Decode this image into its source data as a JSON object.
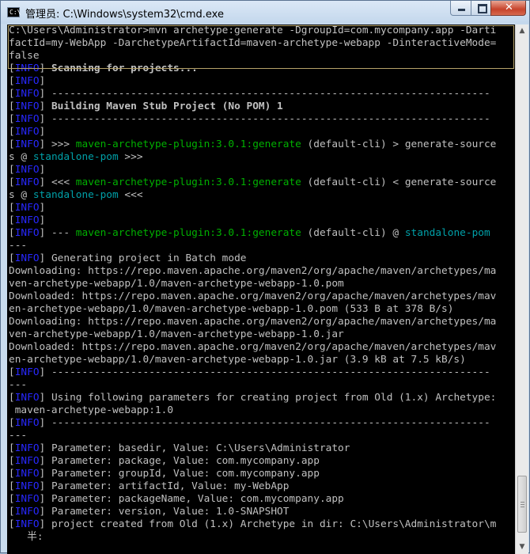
{
  "window": {
    "title": "管理员: C:\\Windows\\system32\\cmd.exe",
    "icon_text": "C:\\",
    "controls": {
      "minimize": "minimize-icon",
      "maximize": "maximize-icon",
      "close": "✕"
    }
  },
  "console": {
    "lines": [
      "C:\\Users\\Administrator>mvn archetype:generate -DgroupId=com.mycompany.app -Darti",
      "factId=my-WebApp -DarchetypeArtifactId=maven-archetype-webapp -DinteractiveMode=",
      "false",
      "[INFO] Scanning for projects...",
      "[INFO]",
      "[INFO] ------------------------------------------------------------------------",
      "[INFO] Building Maven Stub Project (No POM) 1",
      "[INFO] ------------------------------------------------------------------------",
      "[INFO]",
      "[INFO] >>> maven-archetype-plugin:3.0.1:generate (default-cli) > generate-source",
      "s @ standalone-pom >>>",
      "[INFO]",
      "[INFO] <<< maven-archetype-plugin:3.0.1:generate (default-cli) < generate-source",
      "s @ standalone-pom <<<",
      "[INFO]",
      "[INFO]",
      "[INFO] --- maven-archetype-plugin:3.0.1:generate (default-cli) @ standalone-pom",
      "---",
      "[INFO] Generating project in Batch mode",
      "Downloading: https://repo.maven.apache.org/maven2/org/apache/maven/archetypes/ma",
      "ven-archetype-webapp/1.0/maven-archetype-webapp-1.0.pom",
      "Downloaded: https://repo.maven.apache.org/maven2/org/apache/maven/archetypes/mav",
      "en-archetype-webapp/1.0/maven-archetype-webapp-1.0.pom (533 B at 378 B/s)",
      "Downloading: https://repo.maven.apache.org/maven2/org/apache/maven/archetypes/ma",
      "ven-archetype-webapp/1.0/maven-archetype-webapp-1.0.jar",
      "Downloaded: https://repo.maven.apache.org/maven2/org/apache/maven/archetypes/mav",
      "en-archetype-webapp/1.0/maven-archetype-webapp-1.0.jar (3.9 kB at 7.5 kB/s)",
      "[INFO] ------------------------------------------------------------------------",
      "---",
      "[INFO] Using following parameters for creating project from Old (1.x) Archetype:",
      " maven-archetype-webapp:1.0",
      "[INFO] ------------------------------------------------------------------------",
      "---",
      "[INFO] Parameter: basedir, Value: C:\\Users\\Administrator",
      "[INFO] Parameter: package, Value: com.mycompany.app",
      "[INFO] Parameter: groupId, Value: com.mycompany.app",
      "[INFO] Parameter: artifactId, Value: my-WebApp",
      "[INFO] Parameter: packageName, Value: com.mycompany.app",
      "[INFO] Parameter: version, Value: 1.0-SNAPSHOT",
      "[INFO] project created from Old (1.x) Archetype in dir: C:\\Users\\Administrator\\m",
      "   半:"
    ]
  },
  "scrollbar": {
    "up": "▲",
    "down": "▼",
    "position_fraction": 0.93
  },
  "colors": {
    "info": "#2828ff",
    "plugin": "#00b000",
    "pom": "#00a0a8",
    "console_bg": "#000000",
    "console_text": "#c0c0c0"
  }
}
